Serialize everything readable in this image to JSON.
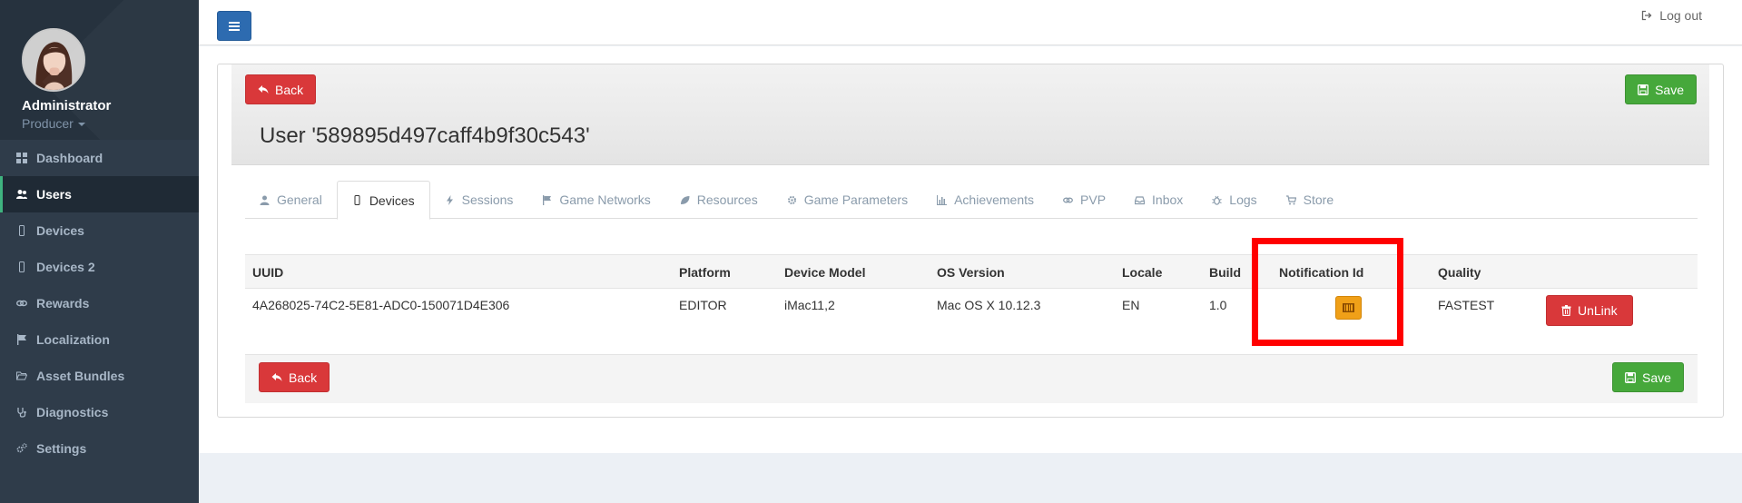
{
  "sidebar": {
    "user": {
      "name": "Administrator",
      "role": "Producer"
    },
    "items": [
      {
        "label": "Dashboard",
        "icon": "dashboard-icon",
        "active": false
      },
      {
        "label": "Users",
        "icon": "users-icon",
        "active": true
      },
      {
        "label": "Devices",
        "icon": "mobile-icon",
        "active": false
      },
      {
        "label": "Devices 2",
        "icon": "mobile-icon",
        "active": false
      },
      {
        "label": "Rewards",
        "icon": "link-icon",
        "active": false
      },
      {
        "label": "Localization",
        "icon": "flag-icon",
        "active": false
      },
      {
        "label": "Asset Bundles",
        "icon": "folder-open-icon",
        "active": false
      },
      {
        "label": "Diagnostics",
        "icon": "stethoscope-icon",
        "active": false
      },
      {
        "label": "Settings",
        "icon": "cogs-icon",
        "active": false
      }
    ]
  },
  "header": {
    "logout_label": "Log out"
  },
  "toolbar": {
    "back_label": "Back",
    "save_label": "Save"
  },
  "page": {
    "title": "User '589895d497caff4b9f30c543'"
  },
  "tabs": [
    {
      "label": "General",
      "icon": "user-icon"
    },
    {
      "label": "Devices",
      "icon": "mobile-icon"
    },
    {
      "label": "Sessions",
      "icon": "bolt-icon"
    },
    {
      "label": "Game Networks",
      "icon": "flag-icon"
    },
    {
      "label": "Resources",
      "icon": "leaf-icon"
    },
    {
      "label": "Game Parameters",
      "icon": "cog-icon"
    },
    {
      "label": "Achievements",
      "icon": "bar-chart-icon"
    },
    {
      "label": "PVP",
      "icon": "link-icon"
    },
    {
      "label": "Inbox",
      "icon": "inbox-icon"
    },
    {
      "label": "Logs",
      "icon": "bug-icon"
    },
    {
      "label": "Store",
      "icon": "cart-icon"
    }
  ],
  "table": {
    "columns": [
      "UUID",
      "Platform",
      "Device Model",
      "OS Version",
      "Locale",
      "Build",
      "Notification Id",
      "Quality"
    ],
    "rows": [
      {
        "uuid": "4A268025-74C2-5E81-ADC0-150071D4E306",
        "platform": "EDITOR",
        "device_model": "iMac11,2",
        "os_version": "Mac OS X 10.12.3",
        "locale": "EN",
        "build": "1.0",
        "quality": "FASTEST",
        "unlink_label": "UnLink"
      }
    ]
  },
  "colors": {
    "sidebar_bg": "#2f3c4a",
    "active_accent": "#3fb37f",
    "danger": "#d9383a",
    "success": "#46a83b",
    "warning": "#f0a018",
    "primary": "#2d6bb0",
    "highlight": "#ff0000"
  }
}
